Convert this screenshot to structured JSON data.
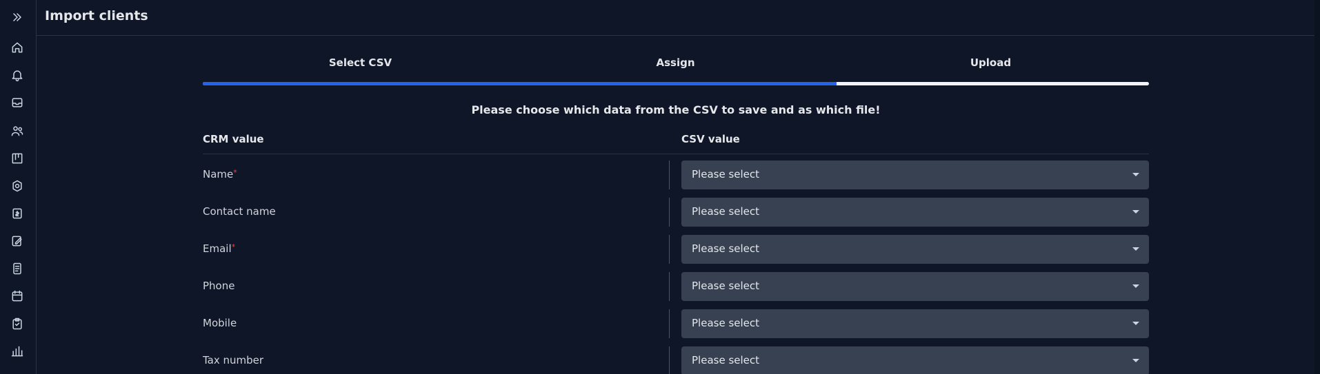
{
  "header": {
    "title": "Import clients"
  },
  "sidebar": {
    "items": [
      {
        "icon": "expand-icon"
      },
      {
        "icon": "home-icon"
      },
      {
        "icon": "bell-icon"
      },
      {
        "icon": "inbox-icon"
      },
      {
        "icon": "users-icon"
      },
      {
        "icon": "kanban-icon"
      },
      {
        "icon": "settings-icon"
      },
      {
        "icon": "invoice-icon"
      },
      {
        "icon": "edit-note-icon"
      },
      {
        "icon": "document-icon"
      },
      {
        "icon": "calendar-icon"
      },
      {
        "icon": "clipboard-check-icon"
      },
      {
        "icon": "bar-chart-icon"
      }
    ]
  },
  "steps": {
    "labels": [
      "Select CSV",
      "Assign",
      "Upload"
    ],
    "progress_percent": 67,
    "accent": "#2563eb"
  },
  "instruction": "Please choose which data from the CSV to save and as which file!",
  "columns": {
    "crm": "CRM value",
    "csv": "CSV value"
  },
  "rows": [
    {
      "label": "Name",
      "required": "*",
      "select": "Please select"
    },
    {
      "label": "Contact name",
      "required": "",
      "select": "Please select"
    },
    {
      "label": "Email",
      "required": "*",
      "select": "Please select"
    },
    {
      "label": "Phone",
      "required": "",
      "select": "Please select"
    },
    {
      "label": "Mobile",
      "required": "",
      "select": "Please select"
    },
    {
      "label": "Tax number",
      "required": "",
      "select": "Please select"
    }
  ]
}
